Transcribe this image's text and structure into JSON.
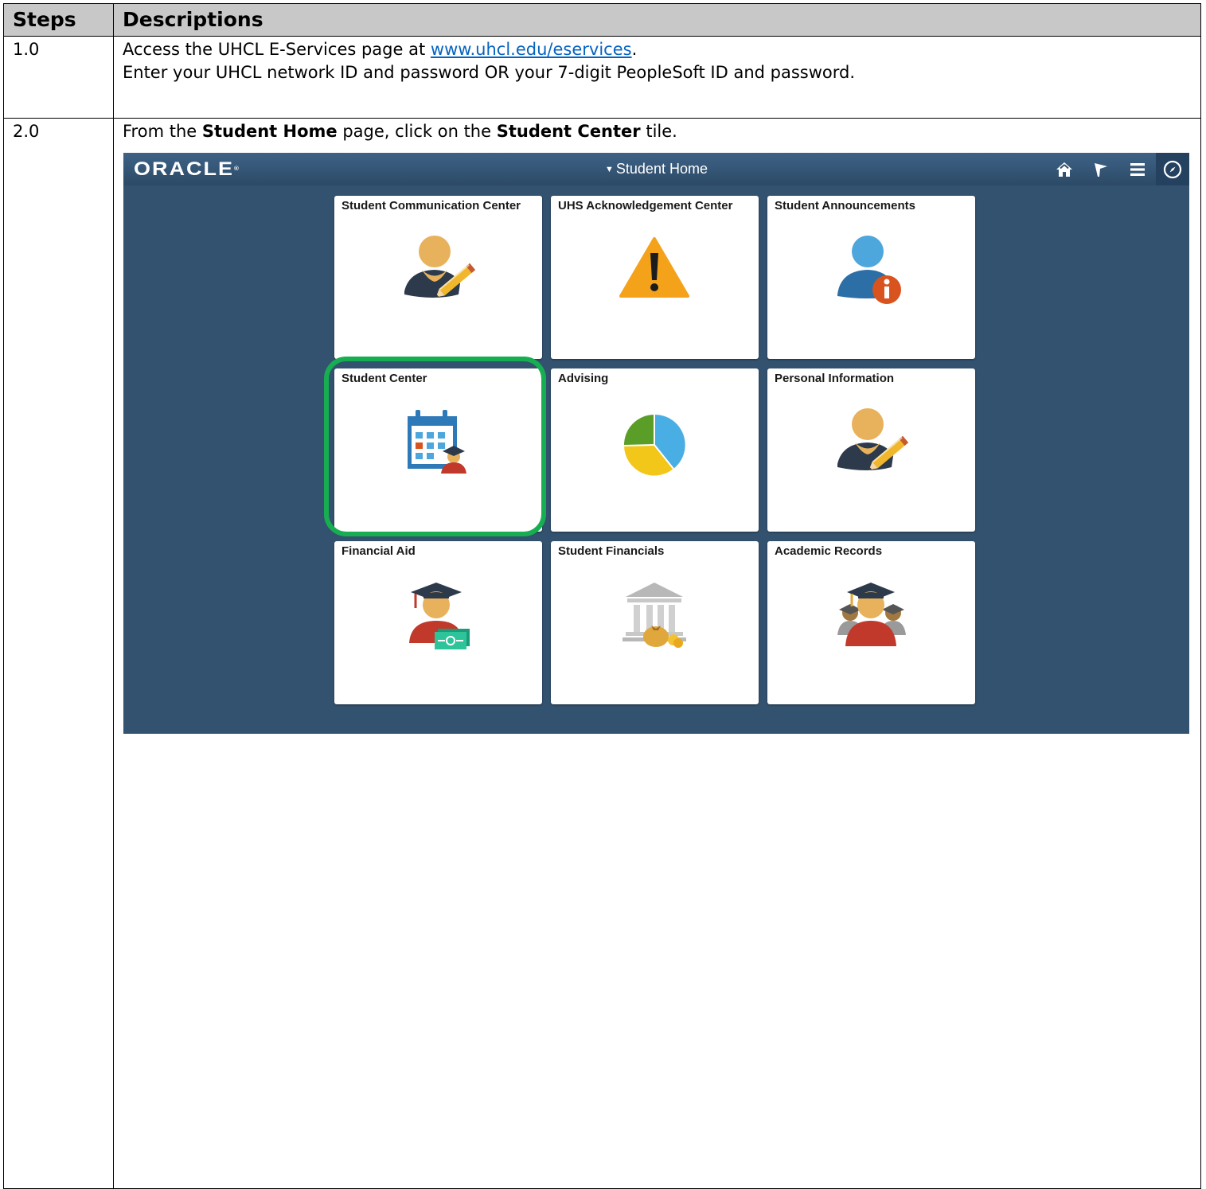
{
  "table": {
    "header_steps": "Steps",
    "header_descriptions": "Descriptions"
  },
  "step1": {
    "number": "1.0",
    "line1_prefix": "Access the UHCL E-Services page at ",
    "line1_link": "www.uhcl.edu/eservices",
    "line1_suffix": ".",
    "line2": "Enter your UHCL network ID and password OR your 7-digit PeopleSoft ID and password."
  },
  "step2": {
    "number": "2.0",
    "p1": "From the ",
    "b1": "Student Home",
    "p2": " page, click on the ",
    "b2": "Student Center",
    "p3": " tile."
  },
  "oracle": {
    "logo": "ORACLE",
    "logo_mark": "®",
    "title": "Student Home",
    "nav_icons": [
      "home-icon",
      "flag-icon",
      "menu-icon",
      "navbar-compass-icon"
    ],
    "tiles": [
      {
        "title": "Student Communication Center",
        "icon": "person-pencil-icon"
      },
      {
        "title": "UHS Acknowledgement Center",
        "icon": "warning-icon"
      },
      {
        "title": "Student Announcements",
        "icon": "person-info-icon"
      },
      {
        "title": "Student Center",
        "icon": "calendar-student-icon"
      },
      {
        "title": "Advising",
        "icon": "pie-chart-icon"
      },
      {
        "title": "Personal Information",
        "icon": "person-pencil-icon"
      },
      {
        "title": "Financial Aid",
        "icon": "graduate-money-icon"
      },
      {
        "title": "Student Financials",
        "icon": "bank-icon"
      },
      {
        "title": "Academic Records",
        "icon": "graduates-group-icon"
      }
    ],
    "colors": {
      "background": "#33526f",
      "highlight": "#17ae52"
    }
  }
}
